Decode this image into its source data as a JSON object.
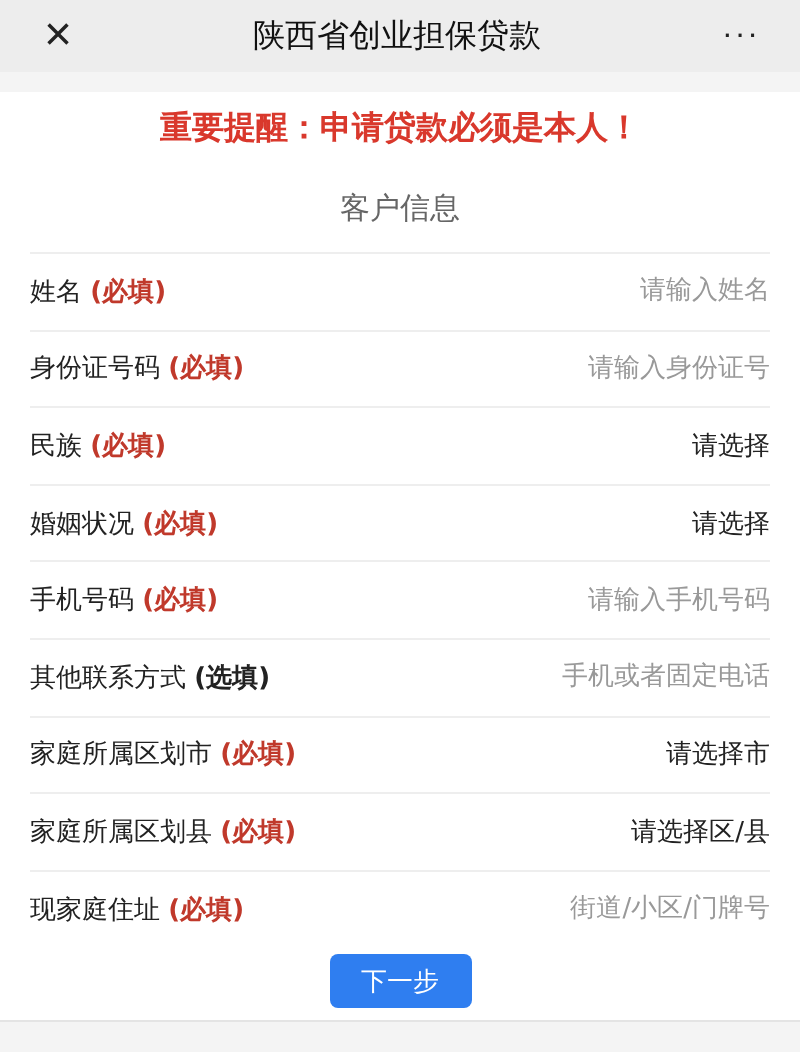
{
  "header": {
    "close": "×",
    "title": "陕西省创业担保贷款",
    "more": "···"
  },
  "notice": "重要提醒：申请贷款必须是本人！",
  "section_title": "客户信息",
  "fields": [
    {
      "label": "姓名",
      "tag": "(必填)",
      "required": true,
      "kind": "input",
      "placeholder": "请输入姓名"
    },
    {
      "label": "身份证号码",
      "tag": "(必填)",
      "required": true,
      "kind": "input",
      "placeholder": "请输入身份证号"
    },
    {
      "label": "民族",
      "tag": "(必填)",
      "required": true,
      "kind": "select",
      "value": "请选择"
    },
    {
      "label": "婚姻状况",
      "tag": "(必填)",
      "required": true,
      "kind": "select",
      "value": "请选择"
    },
    {
      "label": "手机号码",
      "tag": "(必填)",
      "required": true,
      "kind": "input",
      "placeholder": "请输入手机号码"
    },
    {
      "label": "其他联系方式",
      "tag": "(选填)",
      "required": false,
      "kind": "input",
      "placeholder": "手机或者固定电话"
    },
    {
      "label": "家庭所属区划市",
      "tag": "(必填)",
      "required": true,
      "kind": "select",
      "value": "请选择市"
    },
    {
      "label": "家庭所属区划县",
      "tag": "(必填)",
      "required": true,
      "kind": "select",
      "value": "请选择区/县"
    },
    {
      "label": "现家庭住址",
      "tag": "(必填)",
      "required": true,
      "kind": "input",
      "placeholder": "街道/小区/门牌号"
    }
  ],
  "next_button": "下一步"
}
